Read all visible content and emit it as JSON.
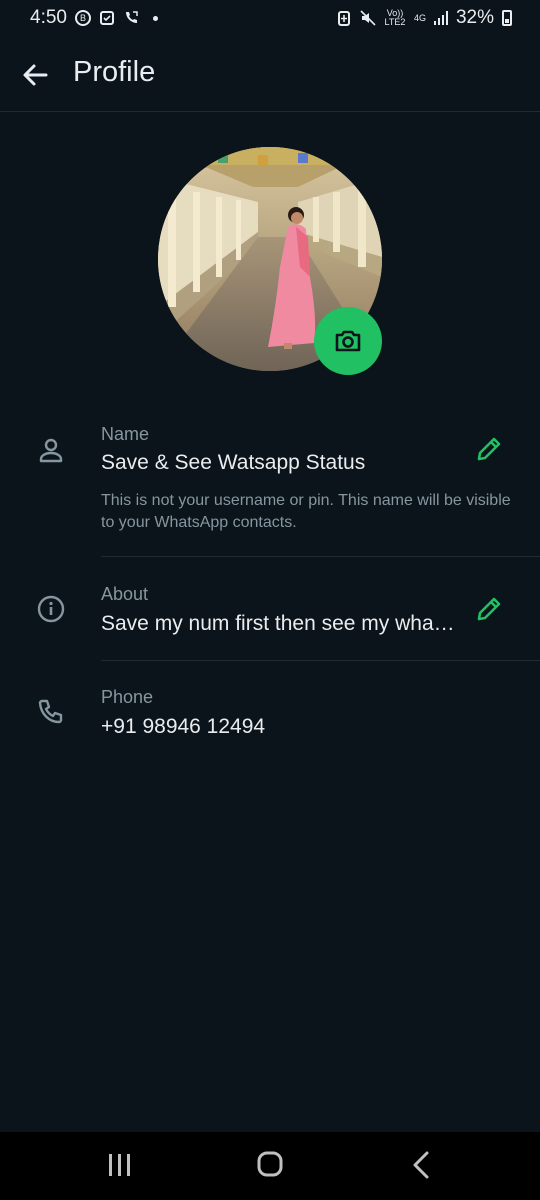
{
  "status_bar": {
    "time": "4:50",
    "volte": "Vo)) LTE2",
    "network": "4G",
    "battery": "32%",
    "icons": [
      "b-circle-icon",
      "calendar-check-icon",
      "call-forward-icon",
      "dot-icon",
      "battery-saver-icon",
      "mute-icon",
      "volte-icon",
      "4g-icon",
      "signal-icon",
      "battery-icon"
    ]
  },
  "header": {
    "title": "Profile",
    "back_icon": "arrow-left-icon"
  },
  "profile": {
    "avatar_alt": "profile-photo",
    "camera_icon": "camera-icon"
  },
  "name": {
    "label": "Name",
    "value": "Save & See Watsapp Status",
    "hint": "This is not your username or pin. This name will be visible to your WhatsApp contacts.",
    "icon": "person-icon",
    "edit_icon": "pencil-icon"
  },
  "about": {
    "label": "About",
    "value": "Save my num first then see my wha…",
    "icon": "info-icon",
    "edit_icon": "pencil-icon"
  },
  "phone": {
    "label": "Phone",
    "value": "+91 98946 12494",
    "icon": "phone-icon"
  },
  "nav": {
    "icons": [
      "recent-apps-icon",
      "home-icon",
      "back-icon"
    ]
  },
  "colors": {
    "background": "#0b141a",
    "accent": "#21c063",
    "text_primary": "#e9edef",
    "text_secondary": "#8696a0",
    "divider": "#1f2c33"
  }
}
